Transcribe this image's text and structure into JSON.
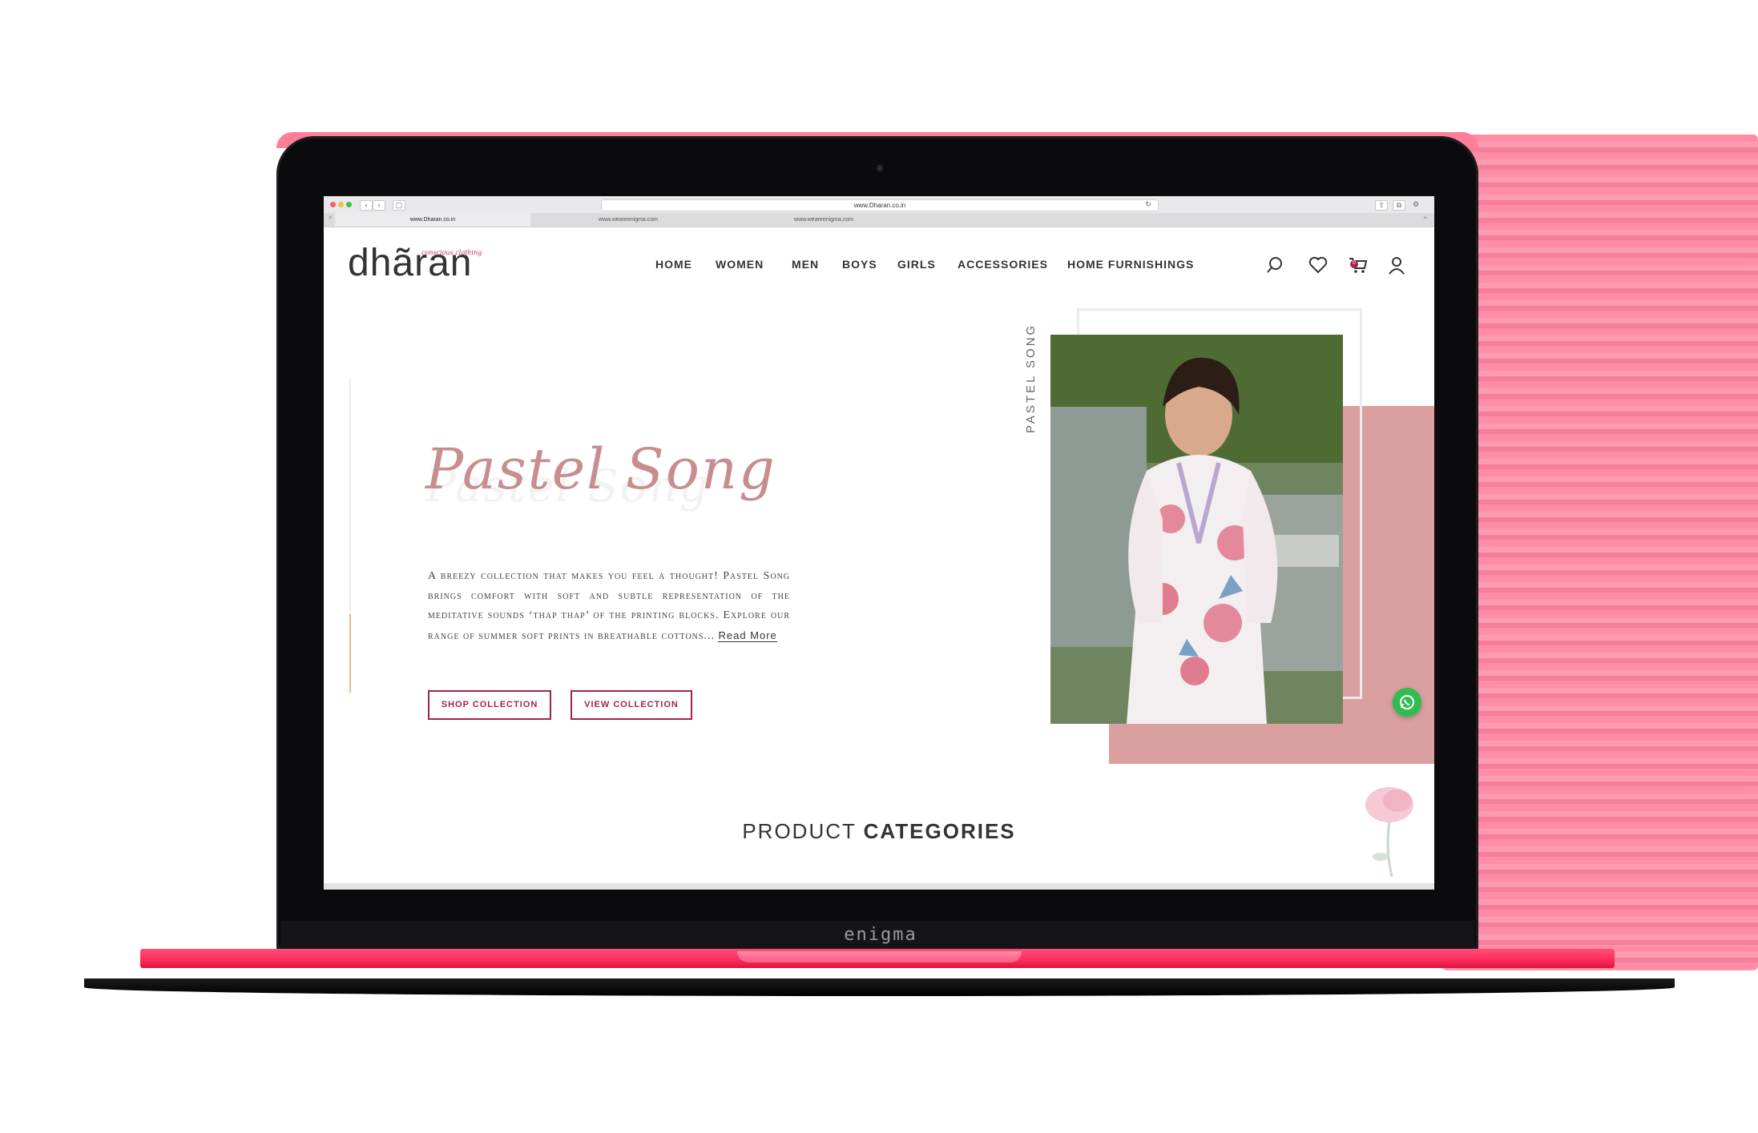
{
  "browser": {
    "url": "www.Dharan.co.in",
    "tabs": [
      "www.Dharan.co.in",
      "www.weareenigma.com",
      "www.weareenigma.com"
    ]
  },
  "site": {
    "logo": "dhãran",
    "tagline": "conscious clothing"
  },
  "nav": {
    "items": [
      "HOME",
      "WOMEN",
      "MEN",
      "BOYS",
      "GIRLS",
      "ACCESSORIES",
      "HOME FURNISHINGS"
    ]
  },
  "header_icons": [
    "search-icon",
    "heart-icon",
    "cart-icon",
    "user-icon"
  ],
  "cart": {
    "count": "0"
  },
  "hero": {
    "title": "Pastel Song",
    "vertical_label": "PASTEL SONG",
    "description": "A breezy collection that makes you feel a thought! Pastel Song brings comfort with soft and subtle representation of the meditative sounds ‘thap thap’ of the printing blocks. Explore our range of summer soft prints in breathable cottons...",
    "read_more": "Read More",
    "shop_button": "SHOP COLLECTION",
    "view_button": "VIEW COLLECTION"
  },
  "section": {
    "title_light": "PRODUCT ",
    "title_bold": "CATEGORIES"
  },
  "device_brand": "enigma",
  "colors": {
    "accent": "#a3224e",
    "pink_block": "#d9a09f",
    "script": "#c78d8f",
    "whatsapp": "#2fbd51",
    "laptop_body": "#ff2a59"
  }
}
